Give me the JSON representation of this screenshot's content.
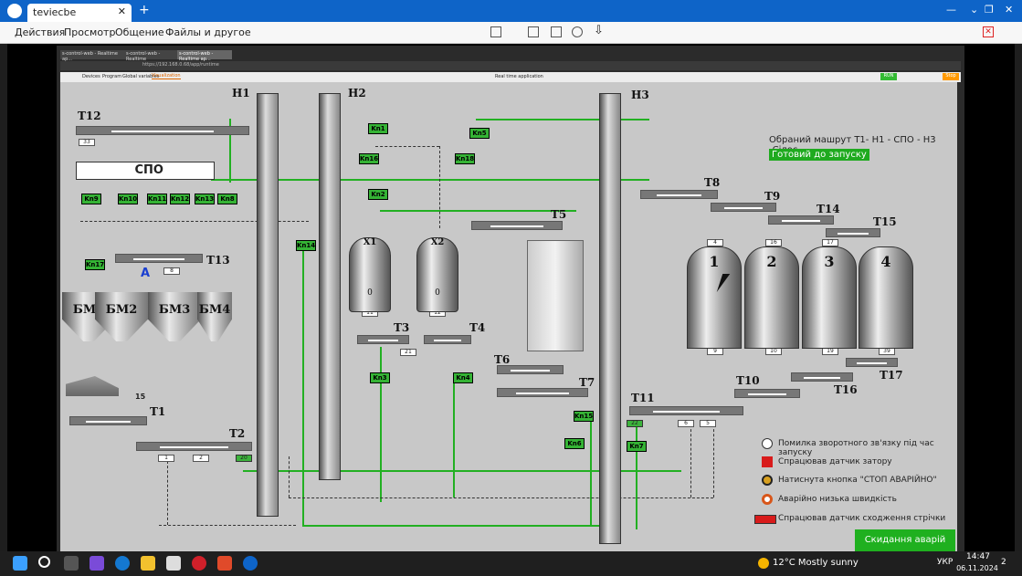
{
  "tv": {
    "tab_title": "teviecbe",
    "menu": {
      "actions": "Действия",
      "view": "Просмотр",
      "comm": "Общение",
      "files": "Файлы и другое"
    }
  },
  "browser": {
    "tabs": [
      "s-control-web - Realtime ap...",
      "s-control-web - Realtime",
      "s-control-web - Realtime ap..."
    ],
    "url": "https://192.168.0.68/app/runtime",
    "nav_tabs": [
      "Devices",
      "Program",
      "Global variables",
      "Visualization"
    ],
    "center_title": "Real time application",
    "run_label": "RUN",
    "stop_label": "Stop"
  },
  "scada": {
    "route_text": "Обраний машрут Т1- Н1 - СПО - Н3 -Сілос",
    "ready_text": "Готовий до запуску",
    "reset_button": "Скидання аварій",
    "spo_label": "СПО",
    "a_label": "A",
    "elevators": [
      "H1",
      "H2",
      "H3"
    ],
    "conveyors": [
      "T1",
      "T2",
      "T3",
      "T4",
      "T5",
      "T6",
      "T7",
      "T8",
      "T9",
      "T10",
      "T11",
      "T12",
      "T13",
      "T14",
      "T15",
      "T16",
      "T17"
    ],
    "valves": [
      "Kn1",
      "Kn2",
      "Kn3",
      "Kn4",
      "Kn5",
      "Kn6",
      "Kn7",
      "Kn8",
      "Kn9",
      "Kn10",
      "Kn11",
      "Kn12",
      "Kn13",
      "Kn14",
      "Kn15",
      "Kn16",
      "Kn17",
      "Kn18"
    ],
    "bins": [
      "БМ1",
      "БМ2",
      "БМ3",
      "БМ4"
    ],
    "hoppers": {
      "x1": "X1",
      "x2": "X2",
      "x1_value": "0",
      "x2_value": "0"
    },
    "silos": [
      "1",
      "2",
      "3",
      "4"
    ],
    "legend": [
      "Помилка зворотного зв'язку під час запуску",
      "Спрацював датчик затору",
      "Натиснута кнопка \"СТОП АВАРІЙНО\"",
      "Аварійно низька швидкість",
      "Спрацював датчик сходження стрічки"
    ],
    "truck_count": "15",
    "box_values": {
      "b33": "33",
      "b1": "1",
      "b2": "2",
      "b20": "20",
      "b8": "8",
      "b14": "14",
      "b13": "13",
      "b11": "11",
      "b12": "12",
      "b21": "21",
      "b4": "4",
      "b9": "9",
      "b10": "10",
      "b19": "19",
      "b39": "39",
      "b5": "5",
      "b6": "6",
      "b22": "22",
      "b16": "16",
      "b17": "17"
    }
  },
  "taskbar": {
    "weather": "12°C  Mostly sunny",
    "lang": "УКР",
    "time": "14:47",
    "date": "06.11.2024",
    "notif": "2"
  }
}
